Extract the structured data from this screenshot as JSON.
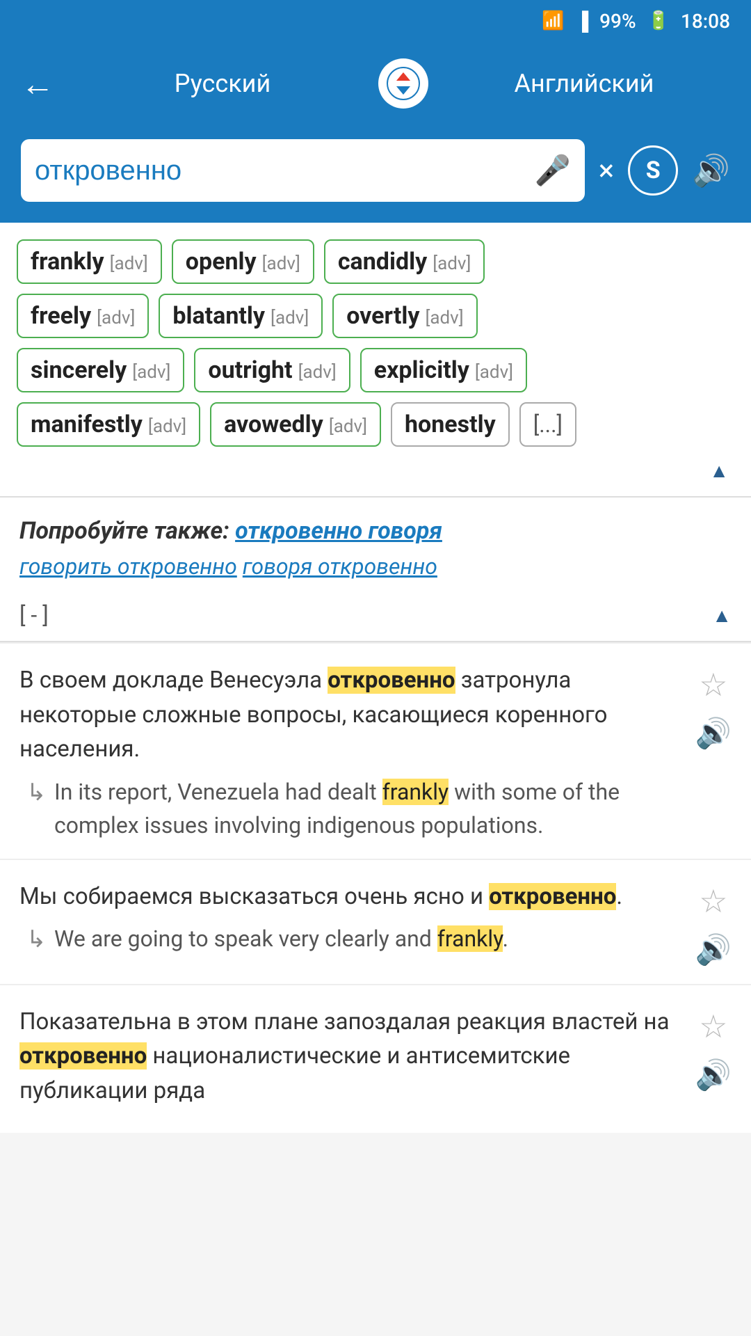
{
  "statusBar": {
    "wifi": "wifi-icon",
    "signal": "signal-icon",
    "battery": "99%",
    "time": "18:08"
  },
  "header": {
    "back": "←",
    "langLeft": "Русский",
    "swap": "⇄",
    "langRight": "Английский"
  },
  "search": {
    "value": "откровенно",
    "micLabel": "mic",
    "clearLabel": "×",
    "spellLabel": "S",
    "soundLabel": "🔊"
  },
  "translations": {
    "chips": [
      {
        "word": "frankly",
        "pos": "[adv]",
        "border": "green"
      },
      {
        "word": "openly",
        "pos": "[adv]",
        "border": "green"
      },
      {
        "word": "candidly",
        "pos": "[adv]",
        "border": "green"
      },
      {
        "word": "freely",
        "pos": "[adv]",
        "border": "green"
      },
      {
        "word": "blatantly",
        "pos": "[adv]",
        "border": "green"
      },
      {
        "word": "overtly",
        "pos": "[adv]",
        "border": "green"
      },
      {
        "word": "sincerely",
        "pos": "[adv]",
        "border": "green"
      },
      {
        "word": "outright",
        "pos": "[adv]",
        "border": "green"
      },
      {
        "word": "explicitly",
        "pos": "[adv]",
        "border": "green"
      },
      {
        "word": "manifestly",
        "pos": "[adv]",
        "border": "green"
      },
      {
        "word": "avowedly",
        "pos": "[adv]",
        "border": "green"
      },
      {
        "word": "honestly",
        "pos": "",
        "border": "grey"
      }
    ],
    "moreBtn": "[...]"
  },
  "tryAlso": {
    "label": "Попробуйте также:",
    "links": [
      "откровенно говоря",
      "говорить откровенно",
      "говоря откровенно"
    ],
    "collapseLabel": "[ - ]"
  },
  "examples": [
    {
      "ru": "В своем докладе Венесуэла откровенно затронула некоторые сложные вопросы, касающиеся коренного населения.",
      "ruHighlight": "откровенно",
      "en": "In its report, Venezuela had dealt frankly with some of the complex issues involving indigenous populations.",
      "enHighlight": "frankly"
    },
    {
      "ru": "Мы собираемся высказаться очень ясно и откровенно.",
      "ruHighlight": "откровенно",
      "en": "We are going to speak very clearly and frankly.",
      "enHighlight": "frankly"
    },
    {
      "ru": "Показательна в этом плане запоздалая реакция властей на откровенно националистические и антисемитские публикации ряда",
      "ruHighlight": "откровенно",
      "en": "",
      "enHighlight": ""
    }
  ]
}
